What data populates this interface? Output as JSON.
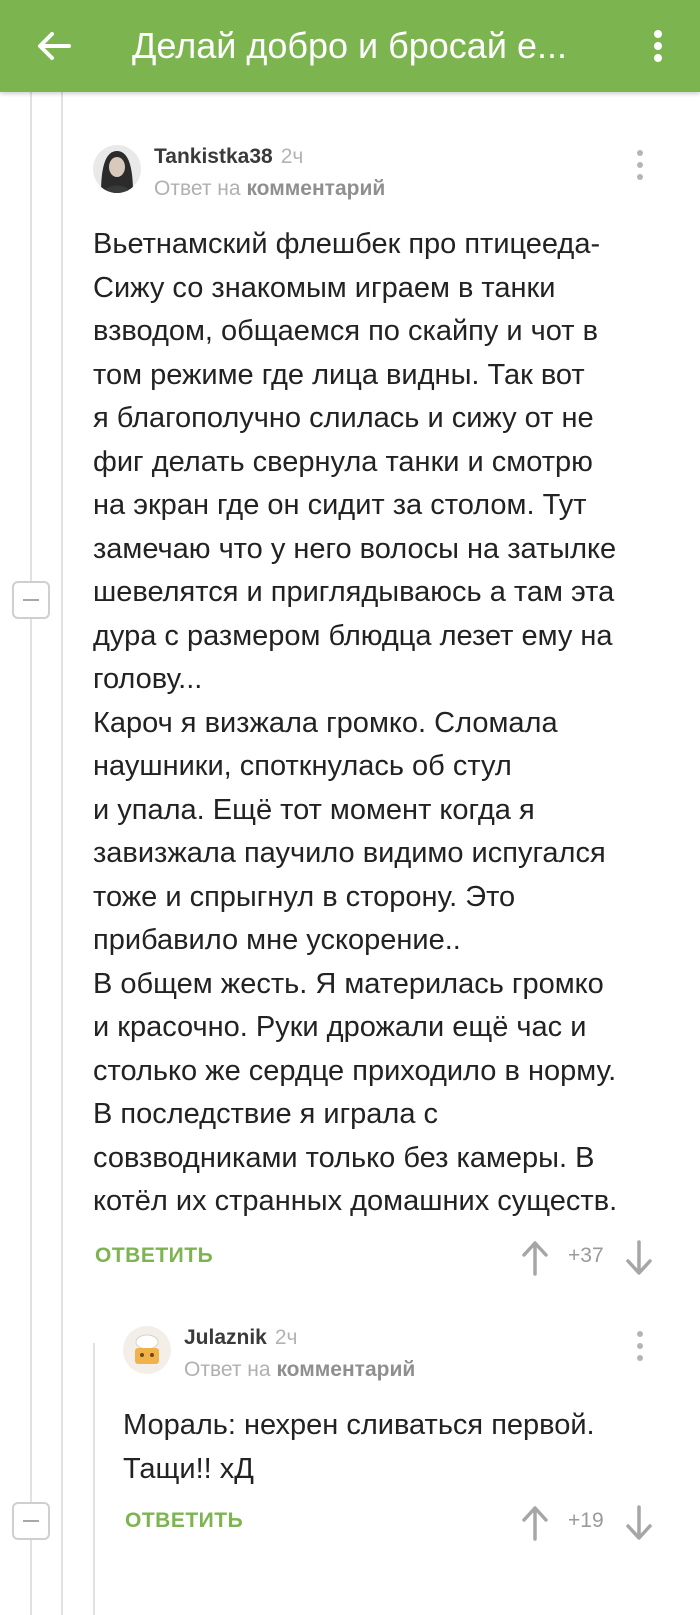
{
  "appbar": {
    "title": "Делай добро и бросай е...",
    "back_icon": "arrow-left-icon",
    "menu_icon": "more-vertical-icon",
    "color": "#7cb44f"
  },
  "comments": [
    {
      "author": "Tankistka38",
      "time": "2ч",
      "reply_prefix": "Ответ на",
      "reply_link": "комментарий",
      "text": "Вьетнамский флешбек про птицееда-\nСижу со знакомым играем в танки\nвзводом, общаемся по скайпу и чот в\nтом режиме где лица видны. Так вот\nя благополучно слилась и сижу от не\nфиг делать свернула танки и смотрю\nна экран где он сидит за столом. Тут\nзамечаю что у него волосы на затылке\nшевелятся и приглядываюсь а там эта\nдура с размером блюдца лезет ему на\nголову...\nКароч я визжала громко. Сломала\nнаушники, споткнулась об стул\nи упала. Ещё тот момент когда я\nзавизжала паучило видимо испугался\nтоже и спрыгнул в сторону. Это\nприбавило мне ускорение..\nВ общем жесть. Я материлась громко\nи красочно. Руки дрожали ещё час и\nстолько же сердце приходило в норму.\nВ последствие я играла с\nсовзводниками только без камеры. В\nкотёл их странных домашних существ.",
      "reply_label": "ОТВЕТИТЬ",
      "rating": "+37"
    },
    {
      "author": "Julaznik",
      "time": "2ч",
      "reply_prefix": "Ответ на",
      "reply_link": "комментарий",
      "text": "Мораль: нехрен сливаться первой.\nТащи!! хД",
      "reply_label": "ОТВЕТИТЬ",
      "rating": "+19"
    }
  ]
}
